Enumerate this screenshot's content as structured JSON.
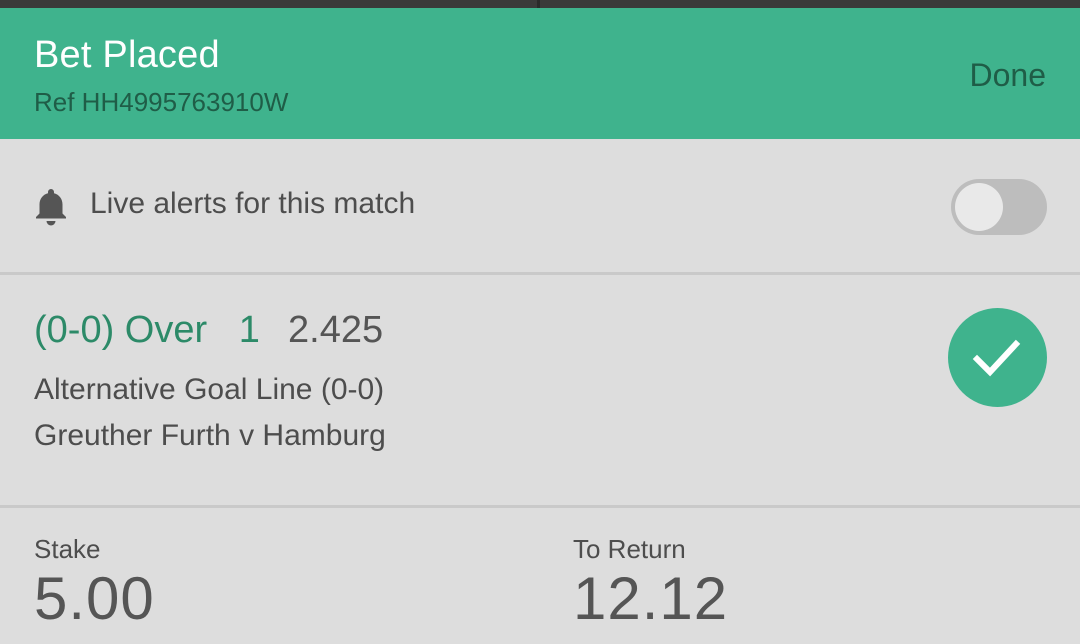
{
  "header": {
    "title": "Bet Placed",
    "ref": "Ref HH4995763910W",
    "done_label": "Done"
  },
  "alerts": {
    "icon": "bell-icon",
    "label": "Live alerts for this match",
    "enabled": false
  },
  "selection": {
    "pick": "(0-0) Over   1",
    "odds": "2.425",
    "market": "Alternative Goal Line (0-0)",
    "event": "Greuther Furth v Hamburg",
    "status_icon": "checkmark-icon"
  },
  "summary": {
    "stake_label": "Stake",
    "stake_value": "5.00",
    "return_label": "To Return",
    "return_value": "12.12"
  },
  "colors": {
    "accent": "#3fb38d",
    "accent_text": "#2c8a68",
    "dark_text": "#1f5d47",
    "background": "#dddddd"
  }
}
